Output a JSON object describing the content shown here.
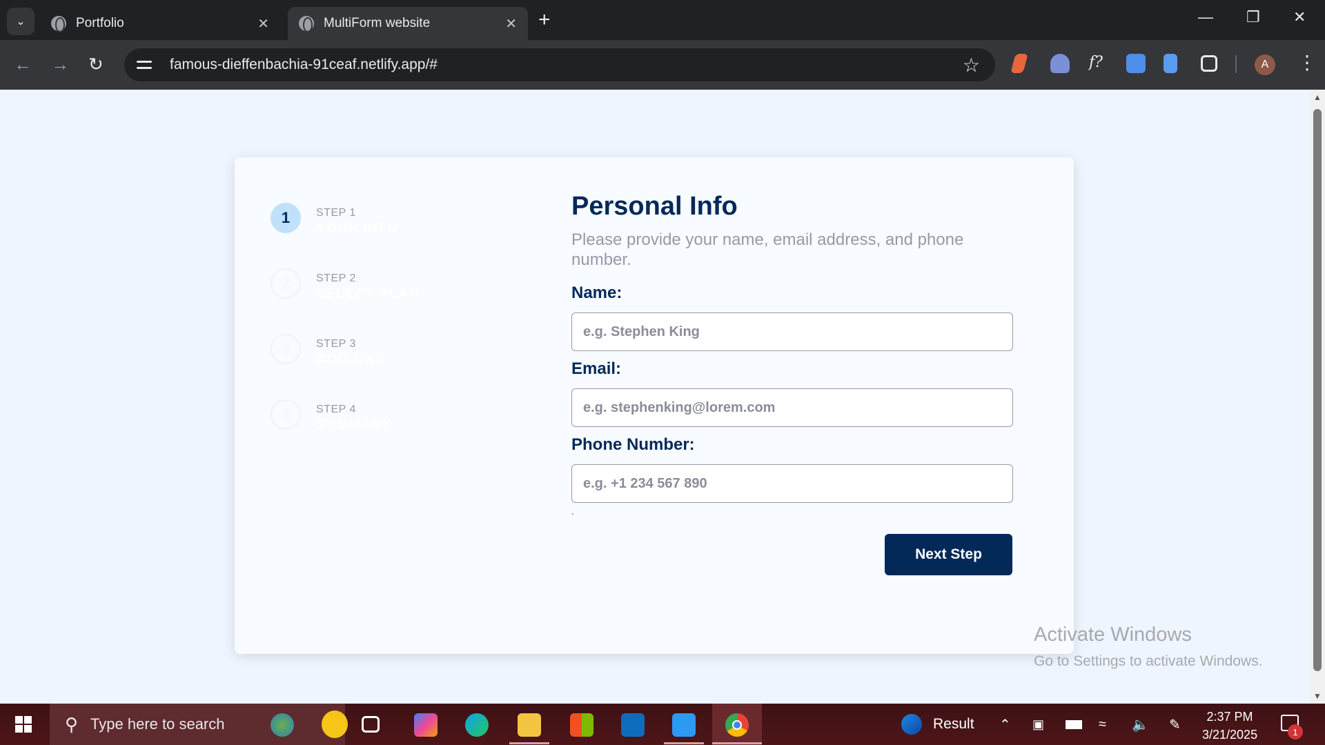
{
  "browser": {
    "tabs": [
      {
        "title": "Portfolio",
        "active": false
      },
      {
        "title": "MultiForm website",
        "active": true
      }
    ],
    "url": "famous-dieffenbachia-91ceaf.netlify.app/#",
    "profile_initial": "A"
  },
  "sidebar": {
    "steps": [
      {
        "number": "1",
        "label": "STEP 1",
        "name": "YOUR INFO",
        "active": true
      },
      {
        "number": "2",
        "label": "STEP 2",
        "name": "SELECT PLAN",
        "active": false
      },
      {
        "number": "3",
        "label": "STEP 3",
        "name": "ADD-ONS",
        "active": false
      },
      {
        "number": "4",
        "label": "STEP 4",
        "name": "SUMMARY",
        "active": false
      }
    ]
  },
  "form": {
    "title": "Personal Info",
    "subtitle": "Please provide your name, email address, and phone number.",
    "name_label": "Name:",
    "name_placeholder": "e.g. Stephen King",
    "email_label": "Email:",
    "email_placeholder": "e.g. stephenking@lorem.com",
    "phone_label": "Phone Number:",
    "phone_placeholder": "e.g. +1 234 567 890",
    "dot": ".",
    "next_button": "Next Step"
  },
  "watermark": {
    "line1": "Activate Windows",
    "line2": "Go to Settings to activate Windows."
  },
  "taskbar": {
    "search_placeholder": "Type here to search",
    "weather_label": "Result",
    "time": "2:37 PM",
    "date": "3/21/2025",
    "notification_count": "1"
  },
  "colors": {
    "accent": "#022958",
    "active_step": "#bfe1fb",
    "page_bg": "#eef5ff"
  }
}
